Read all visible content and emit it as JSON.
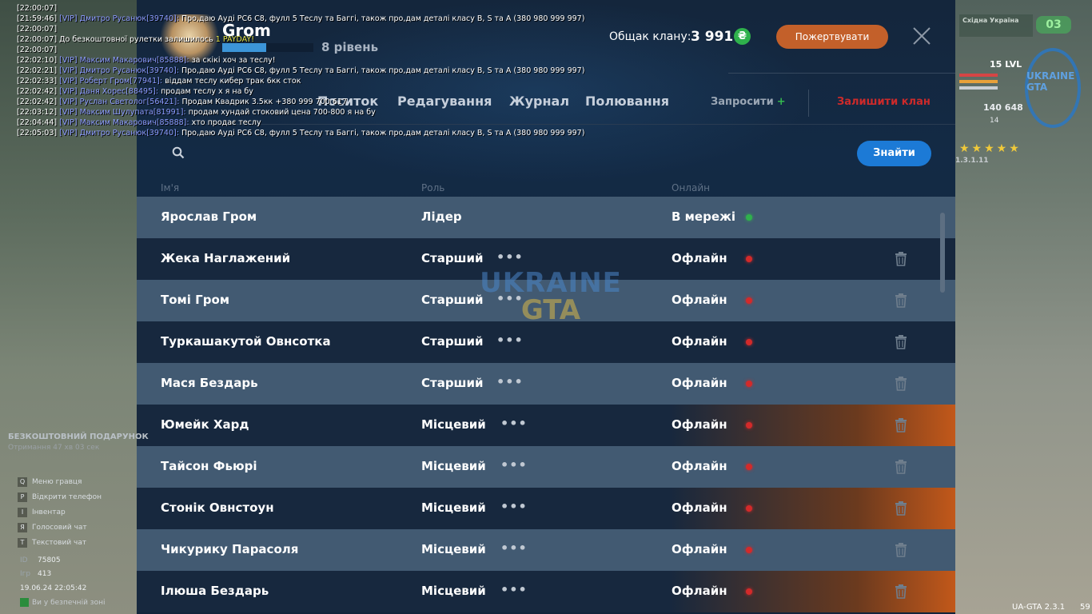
{
  "chat": [
    {
      "time": "[22:00:07]",
      "vip": "",
      "text": ""
    },
    {
      "time": "[21:59:46]",
      "vip": "[VIP] Дмитро Русанюк[39740]:",
      "text": "Про,даю Ауді РС6 С8, фулл 5 Теслу та Баггі, також про,дам деталі класу B, S та A (380 980 999 997)"
    },
    {
      "time": "[22:00:07]",
      "vip": "",
      "text": ""
    },
    {
      "time": "[22:00:07]",
      "vip": "",
      "text": "До безкоштовної рулетки залишилось",
      "highlight": "1 PAYDAY!"
    },
    {
      "time": "[22:00:07]",
      "vip": "",
      "text": ""
    },
    {
      "time": "[22:02:10]",
      "vip": "[VIP] Максим Макарович[85888]:",
      "text": "за скікі хоч за теслу!"
    },
    {
      "time": "[22:02:21]",
      "vip": "[VIP] Дмитро Русанюк[39740]:",
      "text": "Про,даю Ауді РС6 С8, фулл 5 Теслу та Баггі, також про,дам деталі класу B, S та A (380 980 999 997)"
    },
    {
      "time": "[22:02:33]",
      "vip": "[VIP] Роберт Гром[77941]:",
      "text": "віддам теслу кибер трак 6кк сток"
    },
    {
      "time": "[22:02:42]",
      "vip": "[VIP] Даня Хорес[88495]:",
      "text": "продам теслу х я на бу"
    },
    {
      "time": "[22:02:42]",
      "vip": "[VIP] Руслан Светолог[56421]:",
      "text": "Продам Квадрик 3.5кк +380 999 700 617"
    },
    {
      "time": "[22:03:12]",
      "vip": "[VIP] Максим Шулупата[81991]:",
      "text": "продам хундай стоковий цена 700-800 я на бу"
    },
    {
      "time": "[22:04:44]",
      "vip": "[VIP] Максим Макарович[85888]:",
      "text": "хто продає теслу"
    },
    {
      "time": "[22:05:03]",
      "vip": "[VIP] Дмитро Русанюк[39740]:",
      "text": "Про,даю Ауді РС6 С8, фулл 5 Теслу та Баггі, також про,дам деталі класу B, S та A (380 980 999 997)"
    }
  ],
  "header": {
    "clan_name": "Grom",
    "level_label": "8 рівень",
    "level_progress": 0.48,
    "treasury_label": "Общак клану:",
    "treasury_value": "3 991",
    "currency_symbol": "₴",
    "donate_label": "Пожертвувати"
  },
  "nav": {
    "partial_tab": "Поситок",
    "tabs": [
      "Редагування",
      "Журнал",
      "Полювання"
    ],
    "invite_label": "Запросити",
    "invite_plus": "+",
    "leave_label": "Залишити клан"
  },
  "search": {
    "placeholder": "",
    "value": "",
    "button_label": "Знайти"
  },
  "table": {
    "headers": {
      "name": "Ім'я",
      "role": "Роль",
      "online": "Онлайн"
    },
    "rows": [
      {
        "name": "Ярослав Гром",
        "role": "Лідер",
        "status": "В мережі",
        "online": true
      },
      {
        "name": "Жека Наглажений",
        "role": "Старший",
        "status": "Офлайн",
        "online": false
      },
      {
        "name": "Томі Гром",
        "role": "Старший",
        "status": "Офлайн",
        "online": false
      },
      {
        "name": "Туркашакутой Овнсотка",
        "role": "Старший",
        "status": "Офлайн",
        "online": false
      },
      {
        "name": "Мася Бездарь",
        "role": "Старший",
        "status": "Офлайн",
        "online": false
      },
      {
        "name": "Юмейк Хард",
        "role": "Місцевий",
        "status": "Офлайн",
        "online": false
      },
      {
        "name": "Тайсон Фьюрі",
        "role": "Місцевий",
        "status": "Офлайн",
        "online": false
      },
      {
        "name": "Стонік Овнстоун",
        "role": "Місцевий",
        "status": "Офлайн",
        "online": false
      },
      {
        "name": "Чикурику Парасоля",
        "role": "Місцевий",
        "status": "Офлайн",
        "online": false
      },
      {
        "name": "Ілюша Бездарь",
        "role": "Місцевий",
        "status": "Офлайн",
        "online": false
      }
    ]
  },
  "watermark": {
    "line1": "UKRAINE",
    "line2": "GTA"
  },
  "left_hud": {
    "gift_title": "БЕЗКОШТОВНИЙ ПОДАРУНОК",
    "gift_timer": "Отримання 47 хв 03 сек",
    "menu": [
      {
        "key": "Q",
        "label": "Меню гравця"
      },
      {
        "key": "P",
        "label": "Відкрити телефон"
      },
      {
        "key": "I",
        "label": "Інвентар"
      },
      {
        "key": "Я",
        "label": "Голосовий чат"
      },
      {
        "key": "T",
        "label": "Текстовий чат"
      }
    ],
    "id_label": "ID",
    "id_value": "75805",
    "players_label": "Ігр",
    "players_value": "413",
    "datetime": "19.06.24 22:05:42",
    "zone": "Ви у безпечній зоні"
  },
  "right_hud": {
    "region": "Східна Україна",
    "region_count": "03",
    "level": "15 LVL",
    "money": "140 648",
    "small_value": "14",
    "logo": "UKRAINE GTA",
    "stars": "★★★★★",
    "version_small": "1.3.1.11"
  },
  "footer": {
    "version": "UA-GTA 2.3.1",
    "fps": "59"
  },
  "colors": {
    "accent_blue": "#1c7ad6",
    "donate_orange": "#c3602a",
    "leave_red": "#cd2a2a",
    "online_green": "#2fb14c",
    "offline_red": "#d32a2a"
  }
}
